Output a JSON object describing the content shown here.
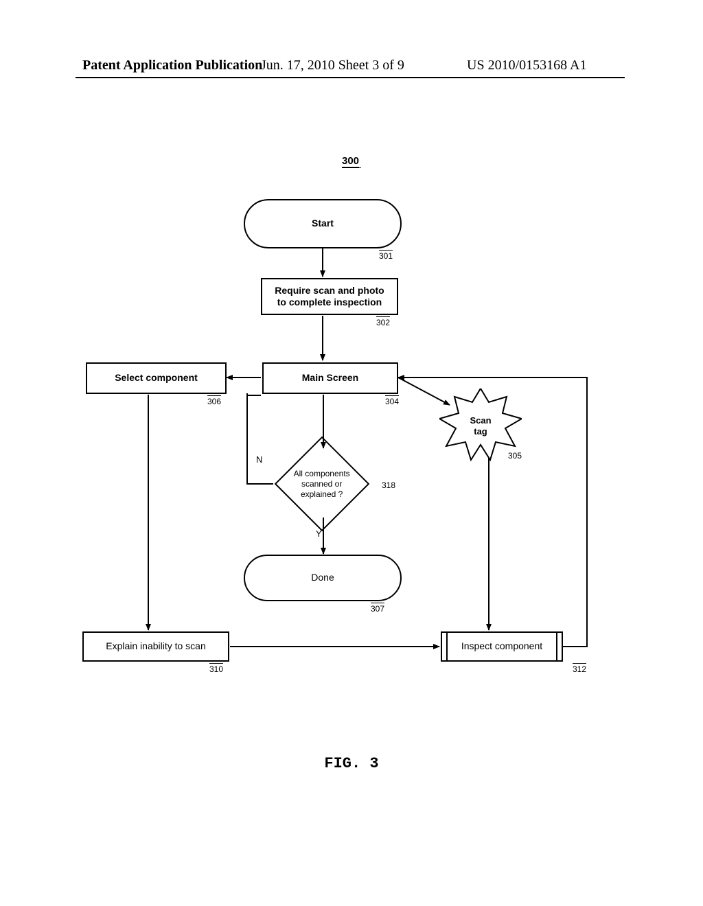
{
  "header": {
    "left": "Patent Application Publication",
    "center": "Jun. 17, 2010  Sheet 3 of 9",
    "right": "US 2010/0153168 A1"
  },
  "figure_ref": "300",
  "nodes": {
    "start": {
      "label": "Start",
      "ref": "301"
    },
    "require": {
      "label": "Require scan and photo\nto complete inspection",
      "ref": "302"
    },
    "main_screen": {
      "label": "Main Screen",
      "ref": "304"
    },
    "select_component": {
      "label": "Select component",
      "ref": "306"
    },
    "scan_tag": {
      "label": "Scan\ntag",
      "ref": "305"
    },
    "decision": {
      "label": "All components scanned\nor explained ?",
      "ref": "318"
    },
    "done": {
      "label": "Done",
      "ref": "307"
    },
    "explain": {
      "label": "Explain inability to scan",
      "ref": "310"
    },
    "inspect": {
      "label": "Inspect component",
      "ref": "312"
    }
  },
  "decision_labels": {
    "no": "N",
    "yes": "Y"
  },
  "figure_caption": "FIG. 3"
}
